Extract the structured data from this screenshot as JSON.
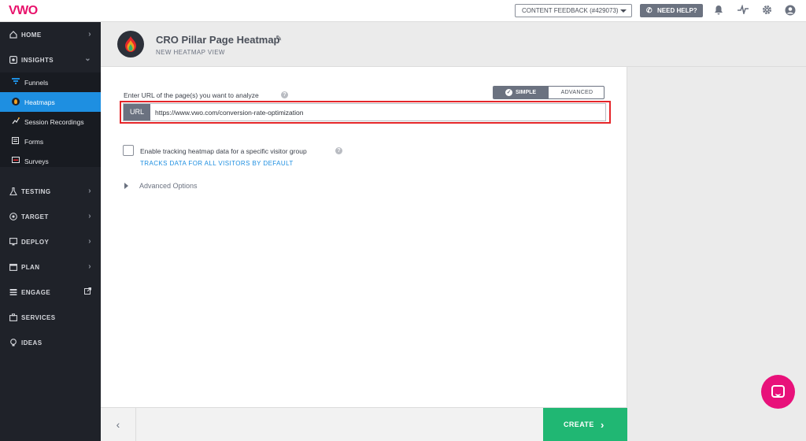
{
  "app": {
    "logo": "VWO"
  },
  "topbar": {
    "feedback_label": "CONTENT FEEDBACK (#429073)",
    "help_label": "NEED HELP?",
    "icons": [
      "bell-icon",
      "activity-icon",
      "gear-icon",
      "user-icon"
    ]
  },
  "sidebar": {
    "items": [
      {
        "label": "HOME",
        "icon": "home-icon",
        "chevron": "right"
      },
      {
        "label": "INSIGHTS",
        "icon": "insights-icon",
        "chevron": "down"
      },
      {
        "label": "TESTING",
        "icon": "flask-icon",
        "chevron": "right"
      },
      {
        "label": "TARGET",
        "icon": "target-icon",
        "chevron": "right"
      },
      {
        "label": "DEPLOY",
        "icon": "deploy-icon",
        "chevron": "right"
      },
      {
        "label": "PLAN",
        "icon": "calendar-icon",
        "chevron": "right"
      },
      {
        "label": "ENGAGE",
        "icon": "engage-icon",
        "chevron": "external"
      },
      {
        "label": "SERVICES",
        "icon": "briefcase-icon",
        "chevron": ""
      },
      {
        "label": "IDEAS",
        "icon": "bulb-icon",
        "chevron": ""
      }
    ],
    "insights_sub": [
      {
        "label": "Funnels",
        "icon": "funnel-icon",
        "active": false
      },
      {
        "label": "Heatmaps",
        "icon": "heatmap-icon",
        "active": true
      },
      {
        "label": "Session Recordings",
        "icon": "recording-icon",
        "active": false
      },
      {
        "label": "Forms",
        "icon": "form-icon",
        "active": false
      },
      {
        "label": "Surveys",
        "icon": "survey-icon",
        "active": false
      }
    ]
  },
  "header": {
    "title": "CRO Pillar Page Heatmap",
    "subtitle": "NEW HEATMAP VIEW"
  },
  "form": {
    "url_label": "Enter URL of the page(s) you want to analyze",
    "mode_simple": "SIMPLE",
    "mode_advanced": "ADVANCED",
    "url_tag": "URL",
    "url_value": "https://www.vwo.com/conversion-rate-optimization",
    "tracking_label": "Enable tracking heatmap data for a specific visitor group",
    "tracking_sub": "TRACKS DATA FOR ALL VISITORS BY DEFAULT",
    "advanced_options": "Advanced Options"
  },
  "footer": {
    "create_label": "CREATE"
  },
  "colors": {
    "sidebar_bg": "#1f2229",
    "active_item": "#1e8fe1",
    "highlight": "#e5262a",
    "create_button": "#20b773",
    "chat_bubble": "#e8117a"
  }
}
